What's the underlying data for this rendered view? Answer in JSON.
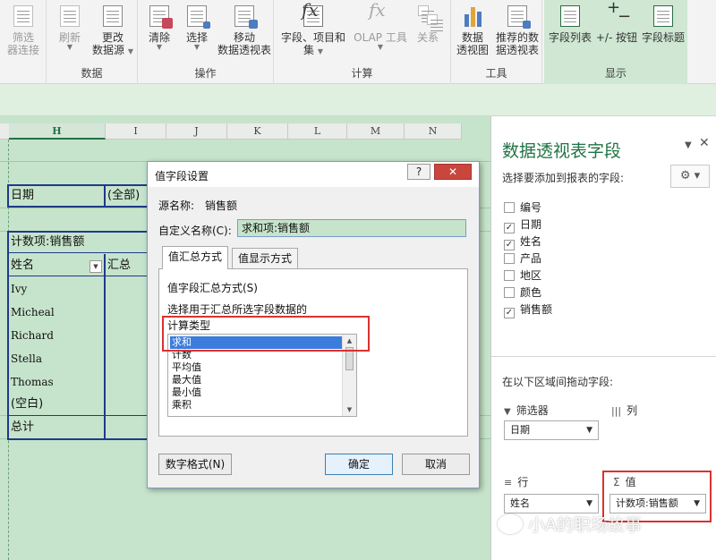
{
  "ribbon": {
    "groups": [
      {
        "label": ""
      },
      {
        "label": "数据"
      },
      {
        "label": "操作"
      },
      {
        "label": "计算"
      },
      {
        "label": "工具"
      },
      {
        "label": "显示"
      }
    ],
    "buttons": {
      "filter_conn": [
        "筛选",
        "器连接"
      ],
      "refresh": "刷新",
      "change_source": [
        "更改",
        "数据源"
      ],
      "clear": "清除",
      "select": "选择",
      "move": [
        "移动",
        "数据透视表"
      ],
      "fields_items": [
        "字段、项目和",
        "集"
      ],
      "olap": "OLAP 工具",
      "relations": "关系",
      "pivot_chart": [
        "数据",
        "透视图"
      ],
      "recommended": [
        "推荐的数",
        "据透视表"
      ],
      "field_list": "字段列表",
      "plus_minus": "+/- 按钮",
      "field_headers": "字段标题"
    }
  },
  "sheet": {
    "columns": [
      "H",
      "I",
      "J",
      "K",
      "L",
      "M",
      "N"
    ],
    "pivot": {
      "filter_label": "日期",
      "filter_value": "(全部)",
      "value_header": "计数项:销售额",
      "row_header": "姓名",
      "sum_header": "汇总",
      "rows": [
        "Ivy",
        "Micheal",
        "Richard",
        "Stella",
        "Thomas",
        "(空白)"
      ],
      "total": "总计"
    }
  },
  "pane": {
    "title": "数据透视表字段",
    "subtitle": "选择要添加到报表的字段:",
    "fields": [
      {
        "label": "编号",
        "checked": false
      },
      {
        "label": "日期",
        "checked": true
      },
      {
        "label": "姓名",
        "checked": true
      },
      {
        "label": "产品",
        "checked": false
      },
      {
        "label": "地区",
        "checked": false
      },
      {
        "label": "颜色",
        "checked": false
      },
      {
        "label": "销售额",
        "checked": true
      }
    ],
    "drag_hint": "在以下区域间拖动字段:",
    "areas": {
      "filters": {
        "title": "筛选器",
        "value": "日期"
      },
      "columns": {
        "title": "列"
      },
      "rows": {
        "title": "行",
        "value": "姓名"
      },
      "values": {
        "title": "值",
        "value": "计数项:销售额"
      }
    }
  },
  "dialog": {
    "title": "值字段设置",
    "help": "?",
    "close": "✕",
    "source_label": "源名称:",
    "source_value": "销售额",
    "custom_label": "自定义名称(C):",
    "custom_value": "求和项:销售额",
    "tabs": [
      "值汇总方式",
      "值显示方式"
    ],
    "section_title": "值字段汇总方式(S)",
    "desc": "选择用于汇总所选字段数据的",
    "calc_type": "计算类型",
    "options": [
      "求和",
      "计数",
      "平均值",
      "最大值",
      "最小值",
      "乘积"
    ],
    "selected": "求和",
    "number_format": "数字格式(N)",
    "ok": "确定",
    "cancel": "取消"
  },
  "watermark": "小A的职场故事"
}
